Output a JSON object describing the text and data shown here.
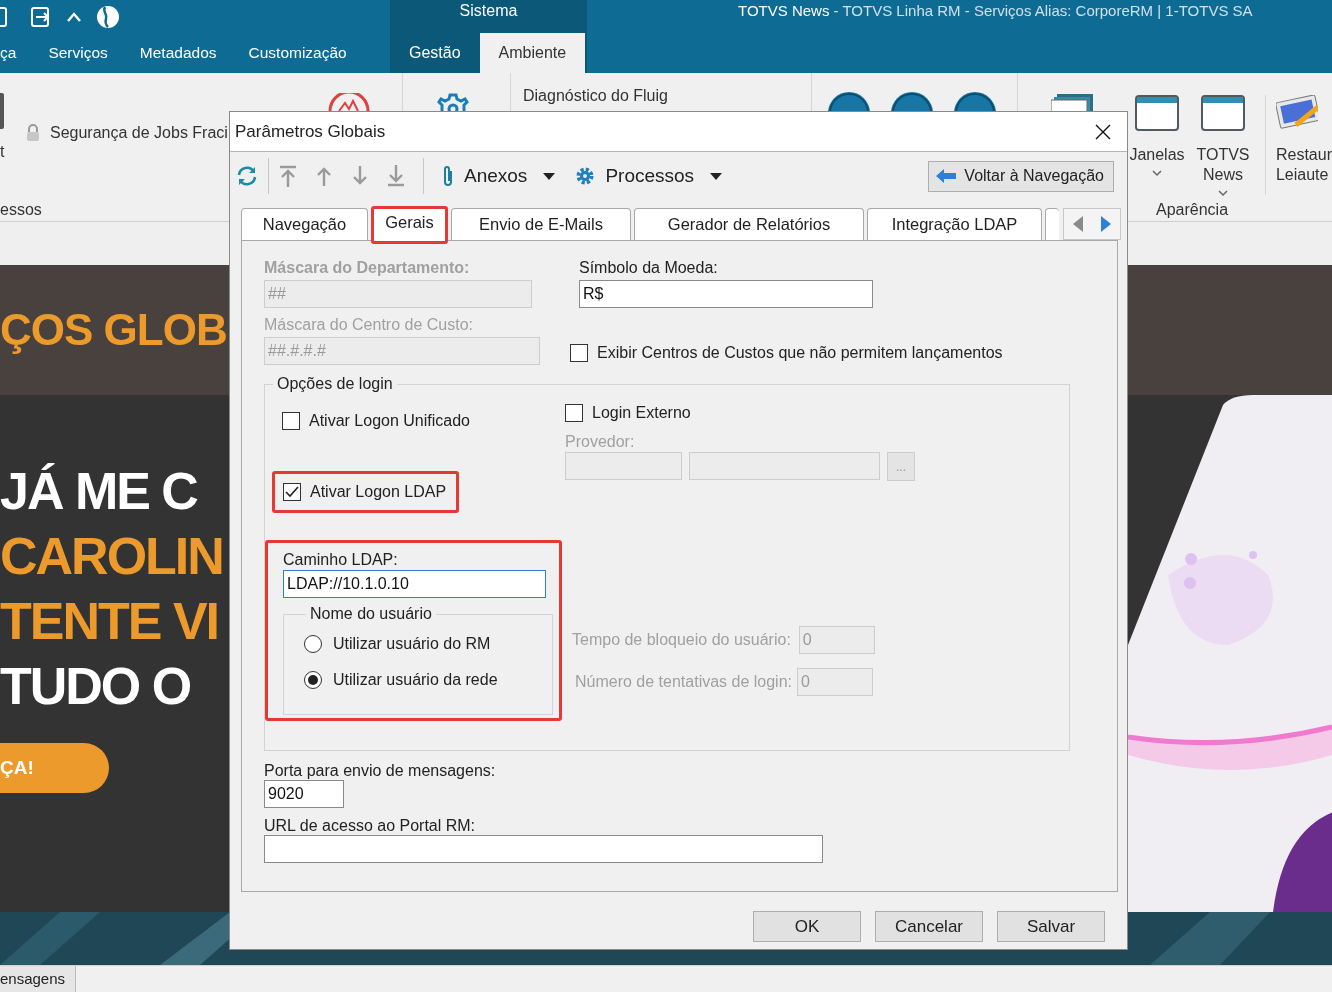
{
  "app": {
    "context_label": "Sistema",
    "title_main": "TOTVS News",
    "title_detail": " - TOTVS Linha RM - Serviços  Alias: CorporeRM | 1-TOTVS SA"
  },
  "ribbon_tabs": [
    {
      "label": "ça",
      "selected": false,
      "contextual": false
    },
    {
      "label": "Serviços",
      "selected": false,
      "contextual": false
    },
    {
      "label": "Metadados",
      "selected": false,
      "contextual": false
    },
    {
      "label": "Customização",
      "selected": false,
      "contextual": false
    },
    {
      "label": "Gestão",
      "selected": false,
      "contextual": true
    },
    {
      "label": "Ambiente",
      "selected": true,
      "contextual": true
    }
  ],
  "ribbon": {
    "left_button_label": "t",
    "security_item": "Segurança de Jobs Fraci",
    "left_group": "essos",
    "diagnostic": "Diagnóstico do Fluig",
    "window_buttons": [
      {
        "lines": [
          "Janelas"
        ]
      },
      {
        "lines": [
          "TOTVS",
          "News"
        ]
      }
    ],
    "restore_lines": [
      "Restaur",
      "Leiaute"
    ],
    "right_group": "Aparência"
  },
  "web": {
    "banner": "ÇOS GLOB",
    "lines": [
      {
        "text": "JÁ ME C",
        "color": "#ffffff"
      },
      {
        "text": "CAROLIN",
        "color": "#ec9a2b"
      },
      {
        "text": "TENTE VI",
        "color": "#ec9a2b"
      },
      {
        "text": "TUDO O",
        "color": "#ffffff"
      }
    ],
    "cta": "ÇA!"
  },
  "status_tab": "ensagens",
  "dialog": {
    "title": "Parâmetros Globais",
    "toolbar": {
      "menus": [
        {
          "label": "Anexos",
          "kind": "clip"
        },
        {
          "label": "Processos",
          "kind": "gear"
        }
      ],
      "back": "Voltar à Navegação"
    },
    "tabs": [
      {
        "label": "Navegação",
        "selected": false,
        "highlighted": false
      },
      {
        "label": "Gerais",
        "selected": true,
        "highlighted": true
      },
      {
        "label": "Envio de E-Mails",
        "selected": false,
        "highlighted": false
      },
      {
        "label": "Gerador de Relatórios",
        "selected": false,
        "highlighted": false
      },
      {
        "label": "Integração LDAP",
        "selected": false,
        "highlighted": false
      }
    ],
    "department_mask": {
      "label": "Máscara do Departamento:",
      "value": "##",
      "disabled": true
    },
    "currency_symbol": {
      "label": "Símbolo da Moeda:",
      "value": "R$",
      "disabled": false
    },
    "cost_center_mask": {
      "label": "Máscara do Centro de Custo:",
      "value": "##.#.#.#",
      "disabled": true
    },
    "show_cost_centers": {
      "label": "Exibir Centros de Custos que não permitem lançamentos",
      "checked": false
    },
    "login_options": {
      "title": "Opções de login",
      "unified": {
        "label": "Ativar Logon Unificado",
        "checked": false
      },
      "ldap": {
        "label": "Ativar Logon LDAP",
        "checked": true,
        "highlighted": true
      },
      "external": {
        "label": "Login Externo",
        "checked": false
      },
      "provider": {
        "label": "Provedor:",
        "disabled": true,
        "more": "..."
      },
      "ldap_section": {
        "highlighted": true,
        "path_label": "Caminho LDAP:",
        "path_value": "LDAP://10.1.0.10",
        "focused": true,
        "user_group": "Nome do usuário",
        "user_options": [
          {
            "label": "Utilizar usuário do RM",
            "selected": false
          },
          {
            "label": "Utilizar usuário da rede",
            "selected": true
          }
        ]
      },
      "lock_time": {
        "label": "Tempo de bloqueio do usuário:",
        "value": "0",
        "disabled": true
      },
      "attempts": {
        "label": "Número de tentativas de login:",
        "value": "0",
        "disabled": true
      }
    },
    "port": {
      "label": "Porta para envio de mensagens:",
      "value": "9020"
    },
    "portal_url": {
      "label": "URL de acesso ao Portal RM:"
    },
    "buttons": [
      "OK",
      "Cancelar",
      "Salvar"
    ]
  }
}
